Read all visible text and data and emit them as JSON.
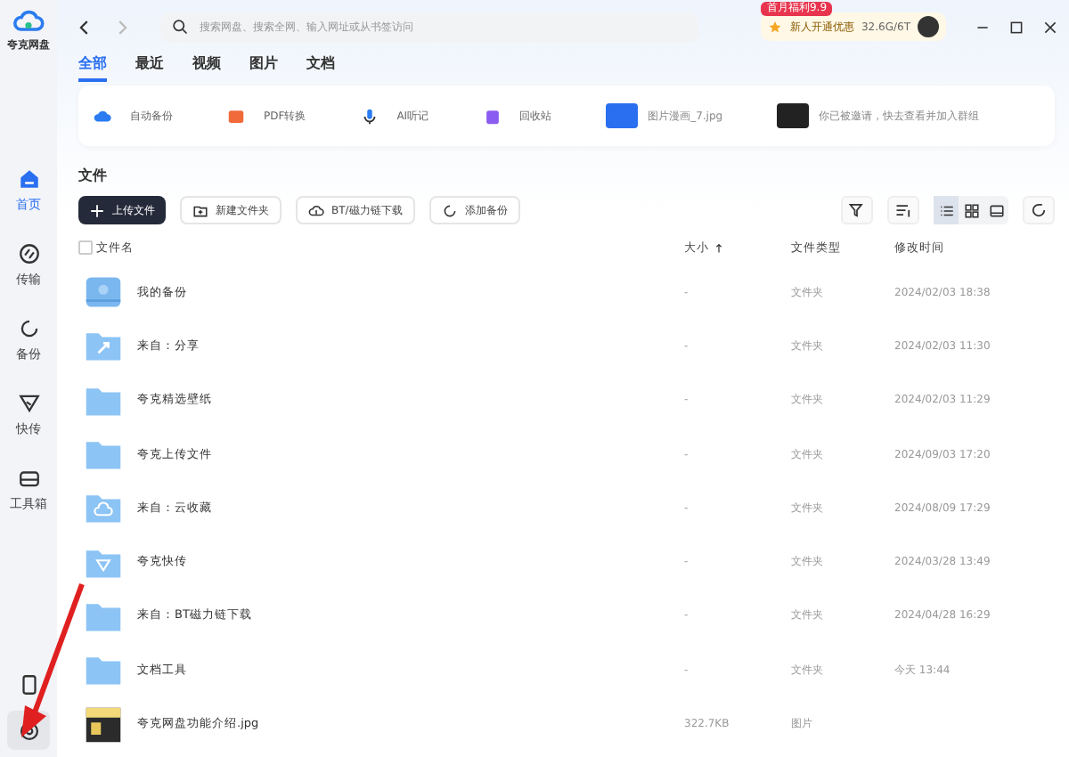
{
  "app": {
    "name": "夸克网盘"
  },
  "sidebar": {
    "items": [
      {
        "label": "首页",
        "selected": true
      },
      {
        "label": "传输",
        "selected": false
      },
      {
        "label": "备份",
        "selected": false
      },
      {
        "label": "快传",
        "selected": false
      },
      {
        "label": "工具箱",
        "selected": false
      }
    ]
  },
  "search": {
    "placeholder": "搜索网盘、搜索全网、输入网址或从书签访问"
  },
  "promo": {
    "badge": "首月福利9.9",
    "label": "新人开通优惠",
    "storage": "32.6G/6T"
  },
  "tabs": [
    {
      "label": "全部",
      "selected": true
    },
    {
      "label": "最近",
      "selected": false
    },
    {
      "label": "视频",
      "selected": false
    },
    {
      "label": "图片",
      "selected": false
    },
    {
      "label": "文档",
      "selected": false
    }
  ],
  "quick_access": [
    {
      "label": "自动备份"
    },
    {
      "label": "PDF转换"
    },
    {
      "label": "AI听记"
    },
    {
      "label": "回收站"
    }
  ],
  "recent": [
    {
      "caption": "图片漫画_7.jpg",
      "kind": "image"
    },
    {
      "caption": "你已被邀请，快去查看并加入群组",
      "kind": "photo"
    }
  ],
  "section_title": "文件",
  "toolbar": {
    "buttons": [
      {
        "label": "上传文件",
        "kind": "primary"
      },
      {
        "label": "新建文件夹",
        "kind": "plain"
      },
      {
        "label": "BT/磁力链下载",
        "kind": "plain"
      },
      {
        "label": "添加备份",
        "kind": "plain"
      }
    ],
    "view": [
      {
        "selected": true
      },
      {
        "selected": false
      },
      {
        "selected": false
      }
    ]
  },
  "table": {
    "select_all": {
      "checked": false
    },
    "columns": [
      "文件名",
      "大小",
      "文件类型",
      "修改时间"
    ],
    "rows": [
      {
        "name": "我的备份",
        "kind": "drive",
        "size": "-",
        "type": "文件夹",
        "modified": "2024/02/03 18:38"
      },
      {
        "name": "来自：分享",
        "kind": "share",
        "size": "-",
        "type": "文件夹",
        "modified": "2024/02/03 11:30"
      },
      {
        "name": "夸克精选壁纸",
        "kind": "folder",
        "size": "-",
        "type": "文件夹",
        "modified": "2024/02/03 11:29"
      },
      {
        "name": "夸克上传文件",
        "kind": "folder",
        "size": "-",
        "type": "文件夹",
        "modified": "2024/09/03 17:20"
      },
      {
        "name": "来自：云收藏",
        "kind": "cloud",
        "size": "-",
        "type": "文件夹",
        "modified": "2024/08/09 17:29"
      },
      {
        "name": "夸克快传",
        "kind": "send",
        "size": "-",
        "type": "文件夹",
        "modified": "2024/03/28 13:49"
      },
      {
        "name": "来自：BT磁力链下载",
        "kind": "folder",
        "size": "-",
        "type": "文件夹",
        "modified": "2024/04/28 16:29"
      },
      {
        "name": "文档工具",
        "kind": "folder",
        "size": "-",
        "type": "文件夹",
        "modified": "今天 13:44"
      },
      {
        "name": "夸克网盘功能介绍.jpg",
        "kind": "image",
        "size": "322.7KB",
        "type": "图片"
      }
    ]
  }
}
